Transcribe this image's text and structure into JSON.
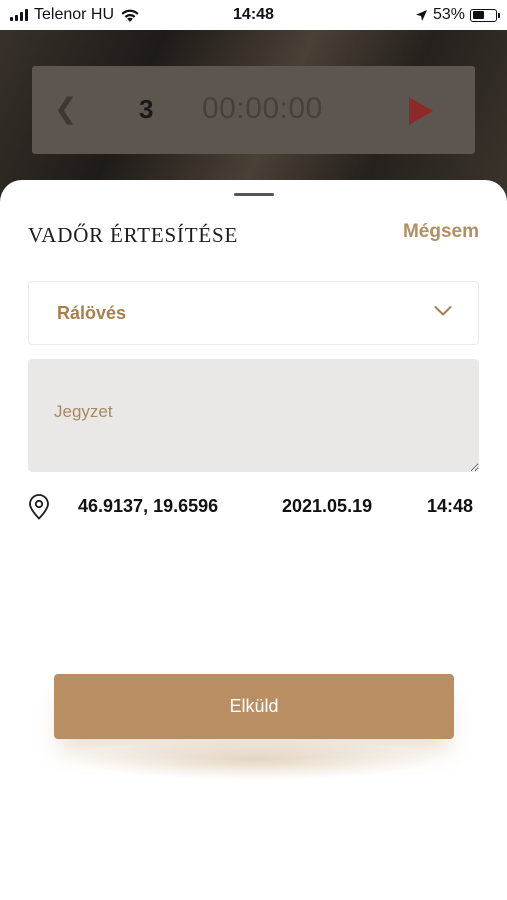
{
  "status_bar": {
    "carrier": "Telenor HU",
    "time": "14:48",
    "battery_percent": "53%",
    "battery_level": 0.53
  },
  "background": {
    "timer_count": "3",
    "timer_clock": "00:00:00"
  },
  "sheet": {
    "title": "VADŐR ÉRTESÍTÉSE",
    "cancel_label": "Mégsem",
    "select_value": "Rálövés",
    "note_placeholder": "Jegyzet",
    "coordinates": "46.9137, 19.6596",
    "date": "2021.05.19",
    "time": "14:48",
    "send_label": "Elküld"
  },
  "colors": {
    "accent": "#b98e62",
    "accent_text": "#a97f4e",
    "note_bg": "#e9e8e6"
  },
  "icons": {
    "signal": "signal-bars-icon",
    "wifi": "wifi-icon",
    "location": "location-arrow-icon",
    "battery": "battery-icon",
    "prev": "chevron-left-icon",
    "play": "play-icon",
    "dropdown": "chevron-down-icon",
    "pin": "map-pin-icon"
  }
}
